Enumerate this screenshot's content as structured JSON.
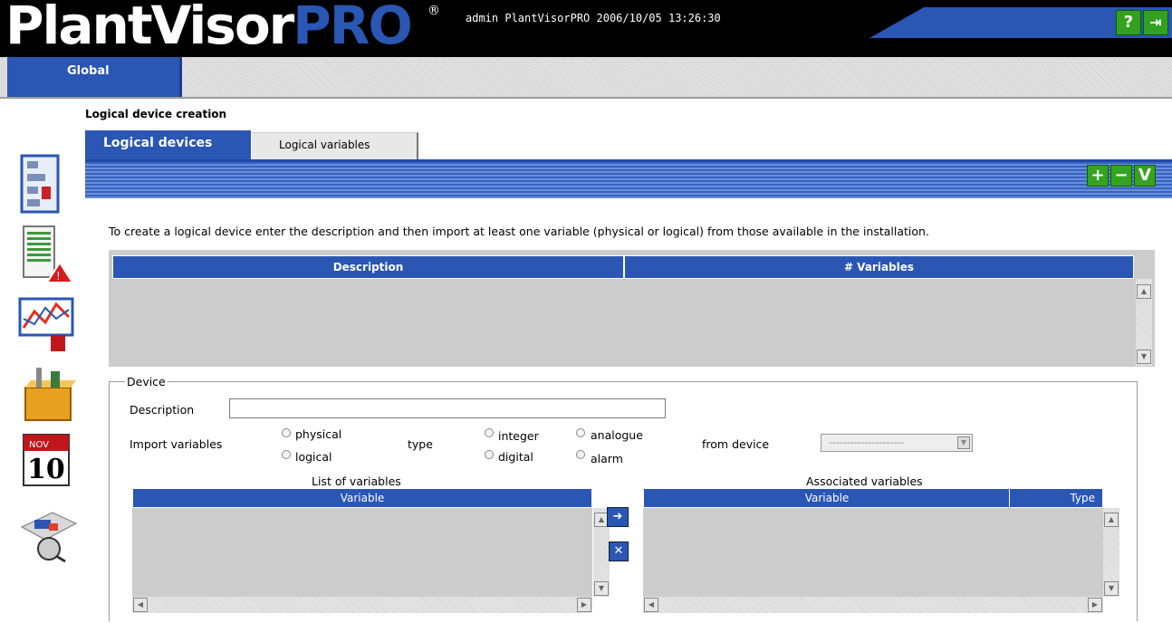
{
  "header": {
    "logo_main": "PlantVisor",
    "logo_accent": "PRO",
    "logo_mark": "®",
    "session": "admin PlantVisorPRO 2006/10/05 13:26:30",
    "help_icon": "question-mark-icon",
    "exit_icon": "exit-door-icon"
  },
  "nav": {
    "global_tab": "Global"
  },
  "sidebar": {
    "icons": [
      "site-layout-icon",
      "alarm-list-icon",
      "graph-icon",
      "tools-box-icon",
      "calendar-icon",
      "plant-schematic-icon"
    ],
    "calendar_month": "NOV",
    "calendar_day": "10"
  },
  "page": {
    "heading": "Logical device creation",
    "tabs": [
      "Logical devices",
      "Logical variables"
    ],
    "toolbar": {
      "add_icon": "plus-icon",
      "remove_icon": "minus-icon",
      "confirm_icon": "check-icon"
    },
    "instructions": "To create a logical device enter the description and then import at least one variable (physical or logical) from those available in the installation.",
    "devices_table": {
      "columns": [
        "Description",
        "# Variables"
      ]
    }
  },
  "device": {
    "legend": "Device",
    "description_label": "Description",
    "description_value": "",
    "import_label": "Import variables",
    "import_options": [
      "physical",
      "logical"
    ],
    "type_label": "type",
    "type_options": [
      "integer",
      "digital",
      "analogue",
      "alarm"
    ],
    "from_device_label": "from device",
    "from_device_value": "---------------------",
    "list_title": "List of variables",
    "list_columns": [
      "Variable"
    ],
    "assoc_title": "Associated variables",
    "assoc_columns": [
      "Variable",
      "Type"
    ],
    "add_var_icon": "arrow-right-icon",
    "remove_var_icon": "x-delete-icon"
  }
}
